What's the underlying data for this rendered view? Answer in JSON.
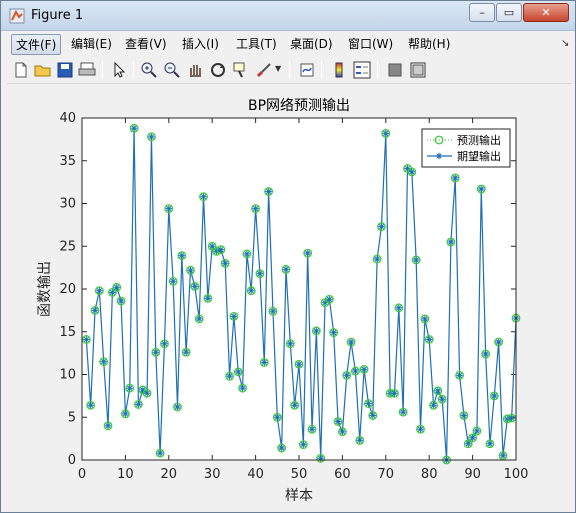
{
  "window": {
    "title": "Figure 1",
    "min_label": "–",
    "max_label": "▭",
    "close_label": "✕"
  },
  "menu": {
    "items": [
      {
        "id": "file",
        "label": "文件(F)",
        "active": true
      },
      {
        "id": "edit",
        "label": "编辑(E)"
      },
      {
        "id": "view",
        "label": "查看(V)"
      },
      {
        "id": "insert",
        "label": "插入(I)"
      },
      {
        "id": "tools",
        "label": "工具(T)"
      },
      {
        "id": "desktop",
        "label": "桌面(D)"
      },
      {
        "id": "window",
        "label": "窗口(W)"
      },
      {
        "id": "help",
        "label": "帮助(H)"
      }
    ],
    "overflow_icon": "chevron-icon"
  },
  "toolbar": {
    "icons": [
      "new-figure-icon",
      "open-icon",
      "save-icon",
      "print-icon",
      "pointer-icon",
      "zoom-in-icon",
      "zoom-out-icon",
      "pan-icon",
      "rotate-icon",
      "data-cursor-icon",
      "brush-icon",
      "link-icon",
      "colorbar-icon",
      "legend-icon",
      "hide-plot-tools-icon",
      "show-plot-tools-icon"
    ]
  },
  "colors": {
    "line": "#1f6fb5",
    "predicted_marker": "#33cc33",
    "axes_bg": "#ffffff",
    "figure_bg": "#f0f0f0"
  },
  "chart_data": {
    "type": "line",
    "title": "BP网络预测输出",
    "xlabel": "样本",
    "ylabel": "函数输出",
    "xlim": [
      0,
      100
    ],
    "ylim": [
      0,
      40
    ],
    "xticks": [
      0,
      10,
      20,
      30,
      40,
      50,
      60,
      70,
      80,
      90,
      100
    ],
    "yticks": [
      0,
      5,
      10,
      15,
      20,
      25,
      30,
      35,
      40
    ],
    "grid": false,
    "legend_position": "top-right",
    "series": [
      {
        "name": "预测输出",
        "marker": "circle",
        "line": "dotted",
        "color": "#33cc33"
      },
      {
        "name": "期望输出",
        "marker": "asterisk",
        "line": "solid",
        "color": "#1f6fb5"
      }
    ],
    "x": [
      1,
      2,
      3,
      4,
      5,
      6,
      7,
      8,
      9,
      10,
      11,
      12,
      13,
      14,
      15,
      16,
      17,
      18,
      19,
      20,
      21,
      22,
      23,
      24,
      25,
      26,
      27,
      28,
      29,
      30,
      31,
      32,
      33,
      34,
      35,
      36,
      37,
      38,
      39,
      40,
      41,
      42,
      43,
      44,
      45,
      46,
      47,
      48,
      49,
      50,
      51,
      52,
      53,
      54,
      55,
      56,
      57,
      58,
      59,
      60,
      61,
      62,
      63,
      64,
      65,
      66,
      67,
      68,
      69,
      70,
      71,
      72,
      73,
      74,
      75,
      76,
      77,
      78,
      79,
      80,
      81,
      82,
      83,
      84,
      85,
      86,
      87,
      88,
      89,
      90,
      91,
      92,
      93,
      94,
      95,
      96,
      97,
      98,
      99,
      100
    ],
    "values": [
      14.1,
      6.4,
      17.5,
      19.8,
      11.5,
      4.0,
      19.6,
      20.2,
      18.6,
      5.4,
      8.4,
      38.8,
      6.5,
      8.2,
      7.8,
      37.8,
      12.6,
      0.8,
      13.6,
      29.4,
      20.9,
      6.2,
      23.9,
      12.6,
      22.2,
      20.3,
      16.5,
      30.8,
      18.9,
      25.0,
      24.4,
      24.6,
      23.0,
      9.8,
      16.8,
      10.3,
      8.4,
      24.1,
      19.8,
      29.4,
      21.8,
      11.4,
      31.4,
      17.4,
      5.0,
      1.4,
      22.3,
      13.6,
      6.4,
      11.2,
      1.8,
      24.2,
      3.6,
      15.1,
      0.2,
      18.4,
      18.8,
      14.9,
      4.5,
      3.3,
      9.9,
      13.8,
      10.4,
      2.3,
      10.6,
      6.6,
      5.2,
      23.5,
      27.3,
      38.2,
      7.8,
      7.8,
      17.8,
      5.6,
      34.1,
      33.7,
      23.4,
      3.6,
      16.5,
      14.1,
      6.4,
      8.1,
      7.1,
      0.0,
      25.5,
      33.0,
      9.9,
      5.2,
      1.9,
      2.6,
      3.4,
      31.7,
      12.4,
      1.9,
      7.5,
      13.8,
      0.5,
      4.8,
      4.9,
      16.6
    ]
  }
}
